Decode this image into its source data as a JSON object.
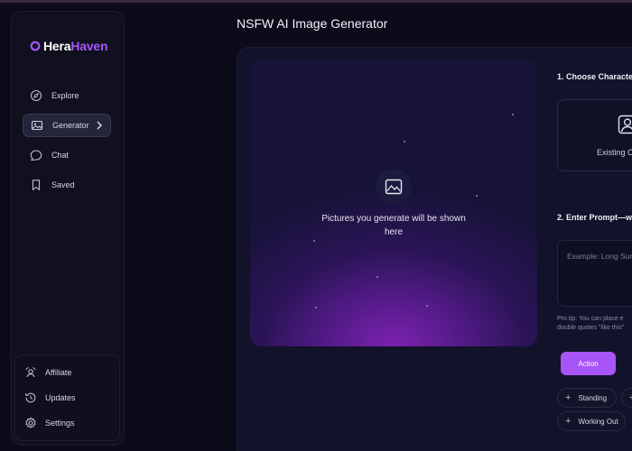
{
  "app": {
    "logo_primary": "Hera",
    "logo_secondary": "Haven",
    "accent_color": "#a855f7"
  },
  "sidebar": {
    "items": [
      {
        "label": "Explore",
        "icon": "compass-icon"
      },
      {
        "label": "Generator",
        "icon": "image-icon",
        "active": true
      },
      {
        "label": "Chat",
        "icon": "chat-icon"
      },
      {
        "label": "Saved",
        "icon": "bookmark-icon"
      }
    ],
    "bottom_items": [
      {
        "label": "Affiliate",
        "icon": "affiliate-icon"
      },
      {
        "label": "Updates",
        "icon": "history-icon"
      },
      {
        "label": "Settings",
        "icon": "gear-icon"
      }
    ]
  },
  "main": {
    "title": "NSFW AI Image Generator",
    "preview_text": "Pictures you generate will be shown here",
    "step1_label": "1. Choose Character",
    "character_option": "Existing Ch",
    "step2_label": "2. Enter Prompt—wh",
    "prompt_placeholder": "Example: Long Sun",
    "protip_line1": "Pro tip: You can place e",
    "protip_line2": "double quotes \"like this\"",
    "action_label": "Action",
    "chips": [
      "Standing",
      "",
      "Working Out"
    ]
  }
}
